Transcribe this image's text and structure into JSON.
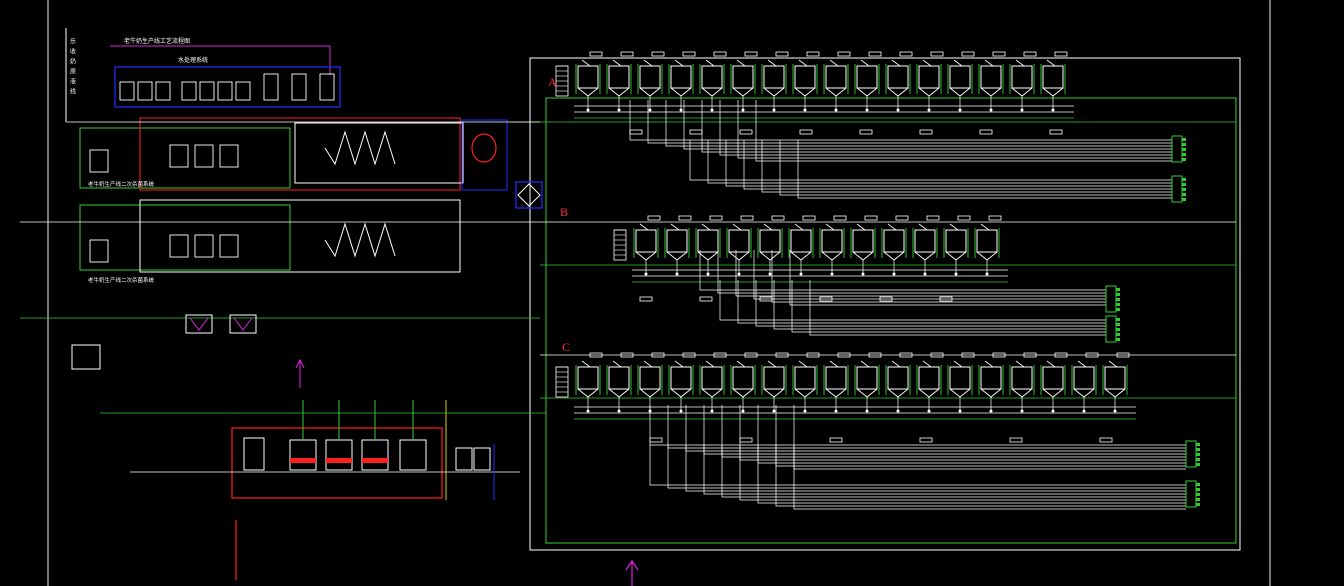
{
  "drawing": {
    "left_margin_label": "乐收奶原液线",
    "top_label_1": "老牛奶生产线工艺流程图",
    "top_label_2": "水处理系统",
    "mid_label_1": "老牛奶生产线二次杀菌系统",
    "mid_label_2": "老牛奶生产线二次杀菌系统"
  },
  "sections": [
    {
      "id": "A",
      "label": "A",
      "tanks": 16
    },
    {
      "id": "B",
      "label": "B",
      "tanks": 12
    },
    {
      "id": "C",
      "label": "C",
      "tanks": 18
    }
  ],
  "colors": {
    "background": "#000000",
    "green": "#33cc33",
    "white": "#ffffff",
    "red": "#ff2020",
    "blue": "#2030ff",
    "magenta": "#e020e0",
    "yellow": "#e0d000",
    "section_letter": "#ff3030",
    "frame": "#c8c8c8"
  }
}
